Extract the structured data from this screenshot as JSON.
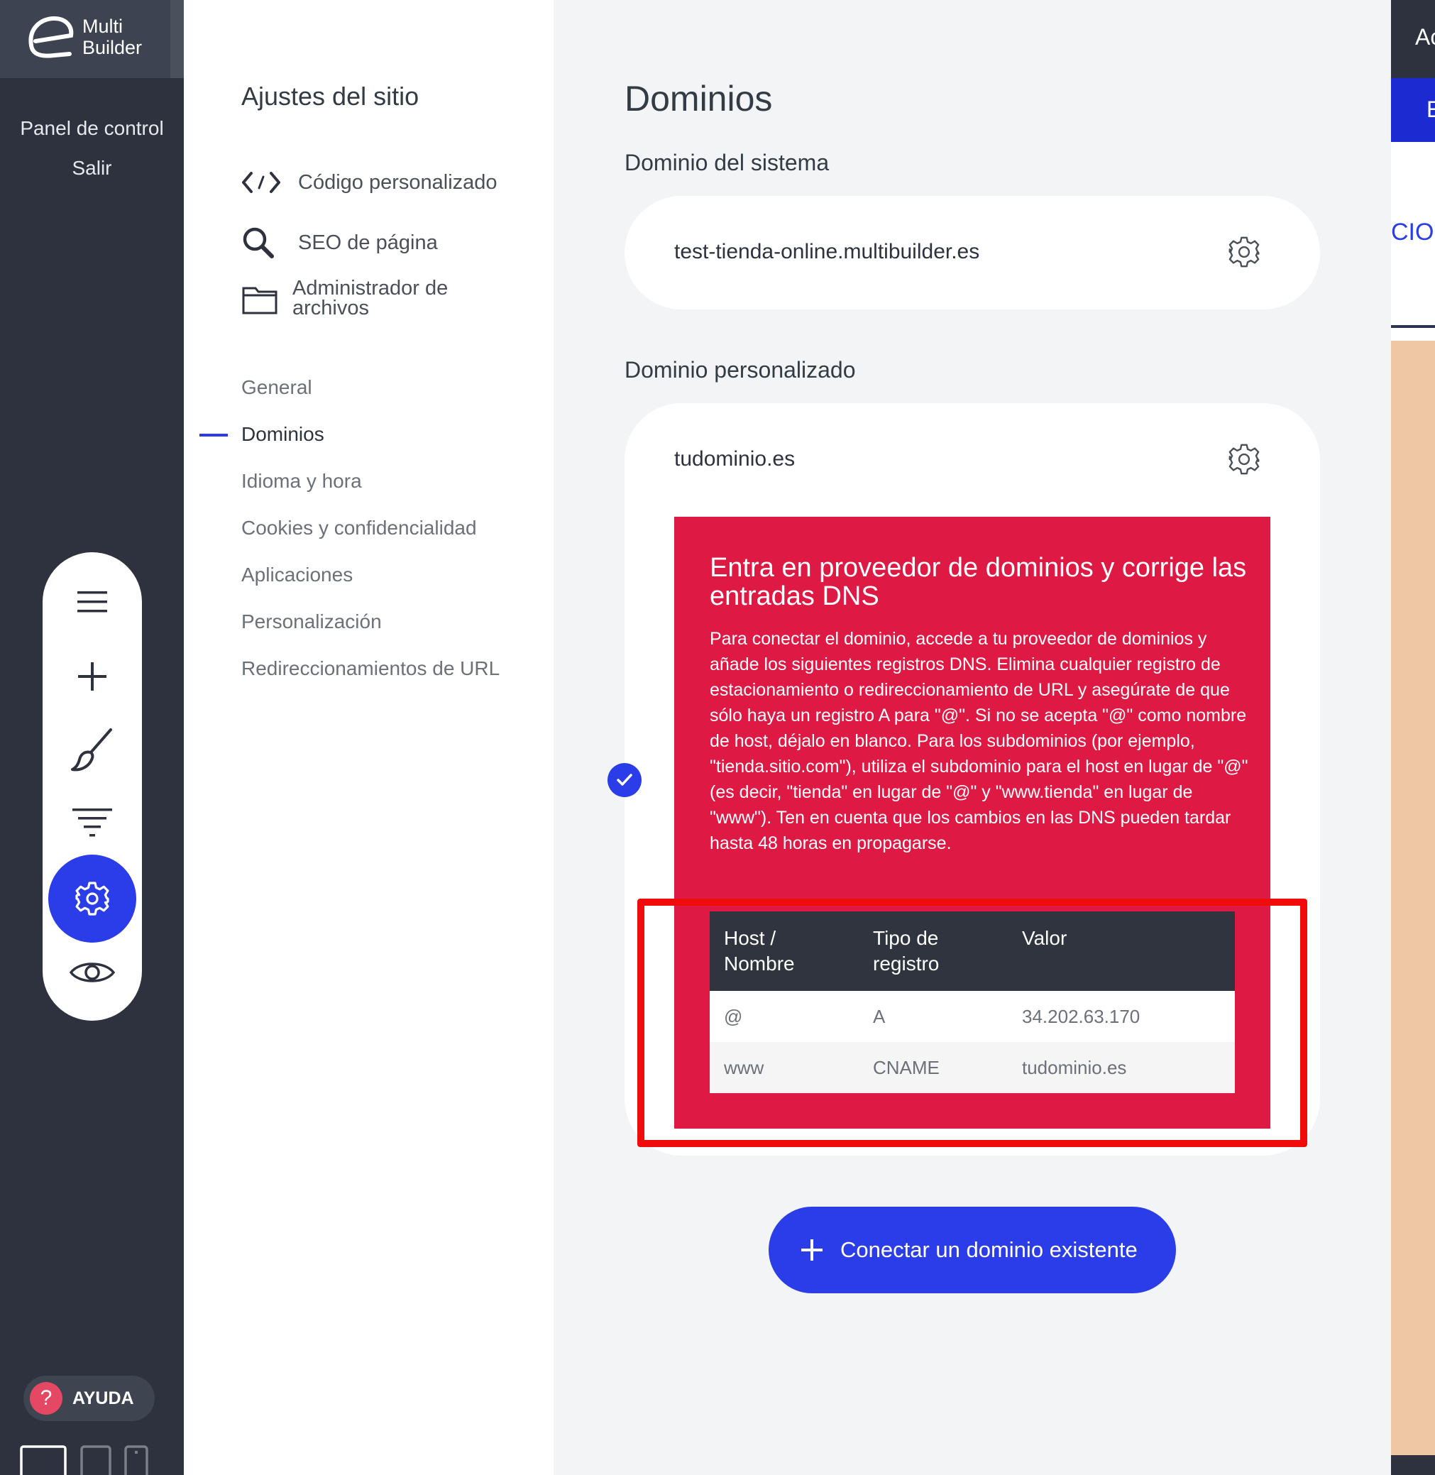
{
  "brand": {
    "line1": "Multi",
    "line2": "Builder"
  },
  "rail": {
    "links": [
      "Panel de control",
      "Salir"
    ],
    "tools": [
      "menu-icon",
      "plus-icon",
      "brush-icon",
      "filter-icon",
      "gear-icon",
      "eye-icon"
    ],
    "active_tool": "gear-icon",
    "help_label": "AYUDA",
    "devices": [
      "desktop-icon",
      "tablet-icon",
      "mobile-icon"
    ]
  },
  "settings_nav": {
    "title": "Ajustes del sitio",
    "tools": [
      {
        "label": "Código personalizado",
        "icon": "code-icon"
      },
      {
        "label": "SEO de página",
        "icon": "search-icon"
      },
      {
        "label": "Administrador de archivos",
        "icon": "folder-icon"
      }
    ],
    "items": [
      "General",
      "Dominios",
      "Idioma y hora",
      "Cookies y confidencialidad",
      "Aplicaciones",
      "Personalización",
      "Redireccionamientos de URL"
    ],
    "active_item": "Dominios"
  },
  "main": {
    "title": "Dominios",
    "system_section": "Dominio del sistema",
    "system_domain": "test-tienda-online.multibuilder.es",
    "custom_section": "Dominio personalizado",
    "custom_domain": "tudominio.es",
    "dns": {
      "title": "Entra en proveedor de dominios y corrige las entradas DNS",
      "description": "Para conectar el dominio, accede a tu proveedor de dominios y añade los siguientes registros DNS. Elimina cualquier registro de estacionamiento o redireccionamiento de URL y asegúrate de que sólo haya un registro A para \"@\". Si no se acepta \"@\" como nombre de host, déjalo en blanco. Para los subdominios (por ejemplo, \"tienda.sitio.com\"), utiliza el subdominio para el host en lugar de \"@\" (es decir, \"tienda\" en lugar de \"@\" y \"www.tienda\" en lugar de \"www\"). Ten en cuenta que los cambios en las DNS pueden tardar hasta 48 horas en propagarse.",
      "columns": [
        "Host / Nombre",
        "Tipo de registro",
        "Valor"
      ],
      "rows": [
        [
          "@",
          "A",
          "34.202.63.170"
        ],
        [
          "www",
          "CNAME",
          "tudominio.es"
        ]
      ]
    },
    "connect_button": "Conectar un dominio existente"
  },
  "preview": {
    "top_text": "Ac",
    "blue_text": "E",
    "heading_text": "CIO"
  },
  "colors": {
    "rail": "#2d323e",
    "accent": "#2b3de8",
    "dns_alert": "#de1944",
    "highlight": "#f10c0c",
    "preview_bg": "#efc7a4"
  }
}
